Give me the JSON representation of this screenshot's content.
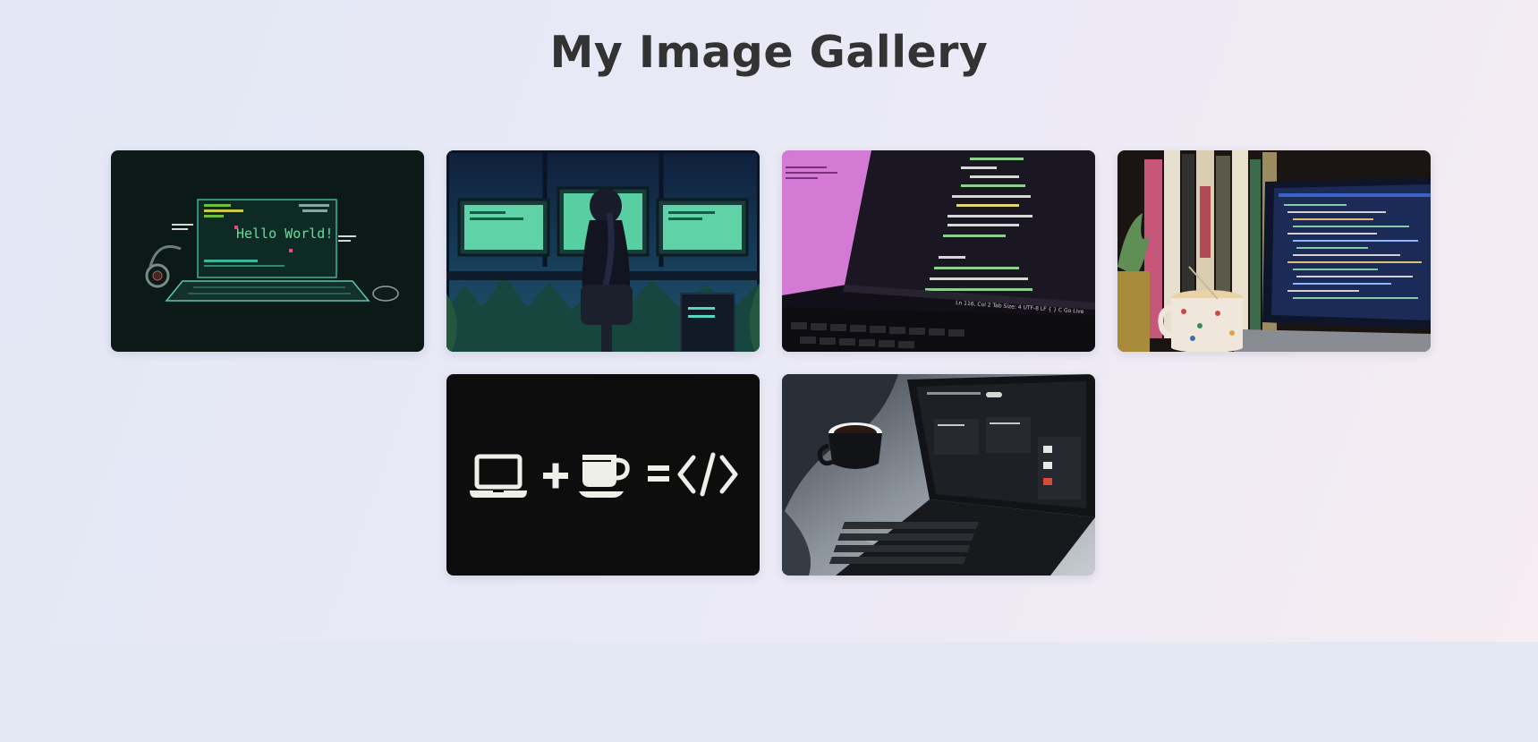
{
  "header": {
    "title": "My Image Gallery"
  },
  "gallery": {
    "images": [
      {
        "subject": "hello-world-laptop",
        "caption": "Hello World!"
      },
      {
        "subject": "programmer-night-desk"
      },
      {
        "subject": "code-editor-laptop",
        "editor_status": "Ln 116, Col 2   Tab Size: 4   UTF-8   LF   { } C   Go Live"
      },
      {
        "subject": "books-coffee-laptop"
      },
      {
        "subject": "laptop-coffee-code-equation"
      },
      {
        "subject": "laptop-on-bed-with-coffee"
      }
    ]
  },
  "colors": {
    "background": "#e4e8f4",
    "title": "#333333",
    "terminal_green": "#5fe39a",
    "monitor_cyan": "#57d6c4"
  }
}
